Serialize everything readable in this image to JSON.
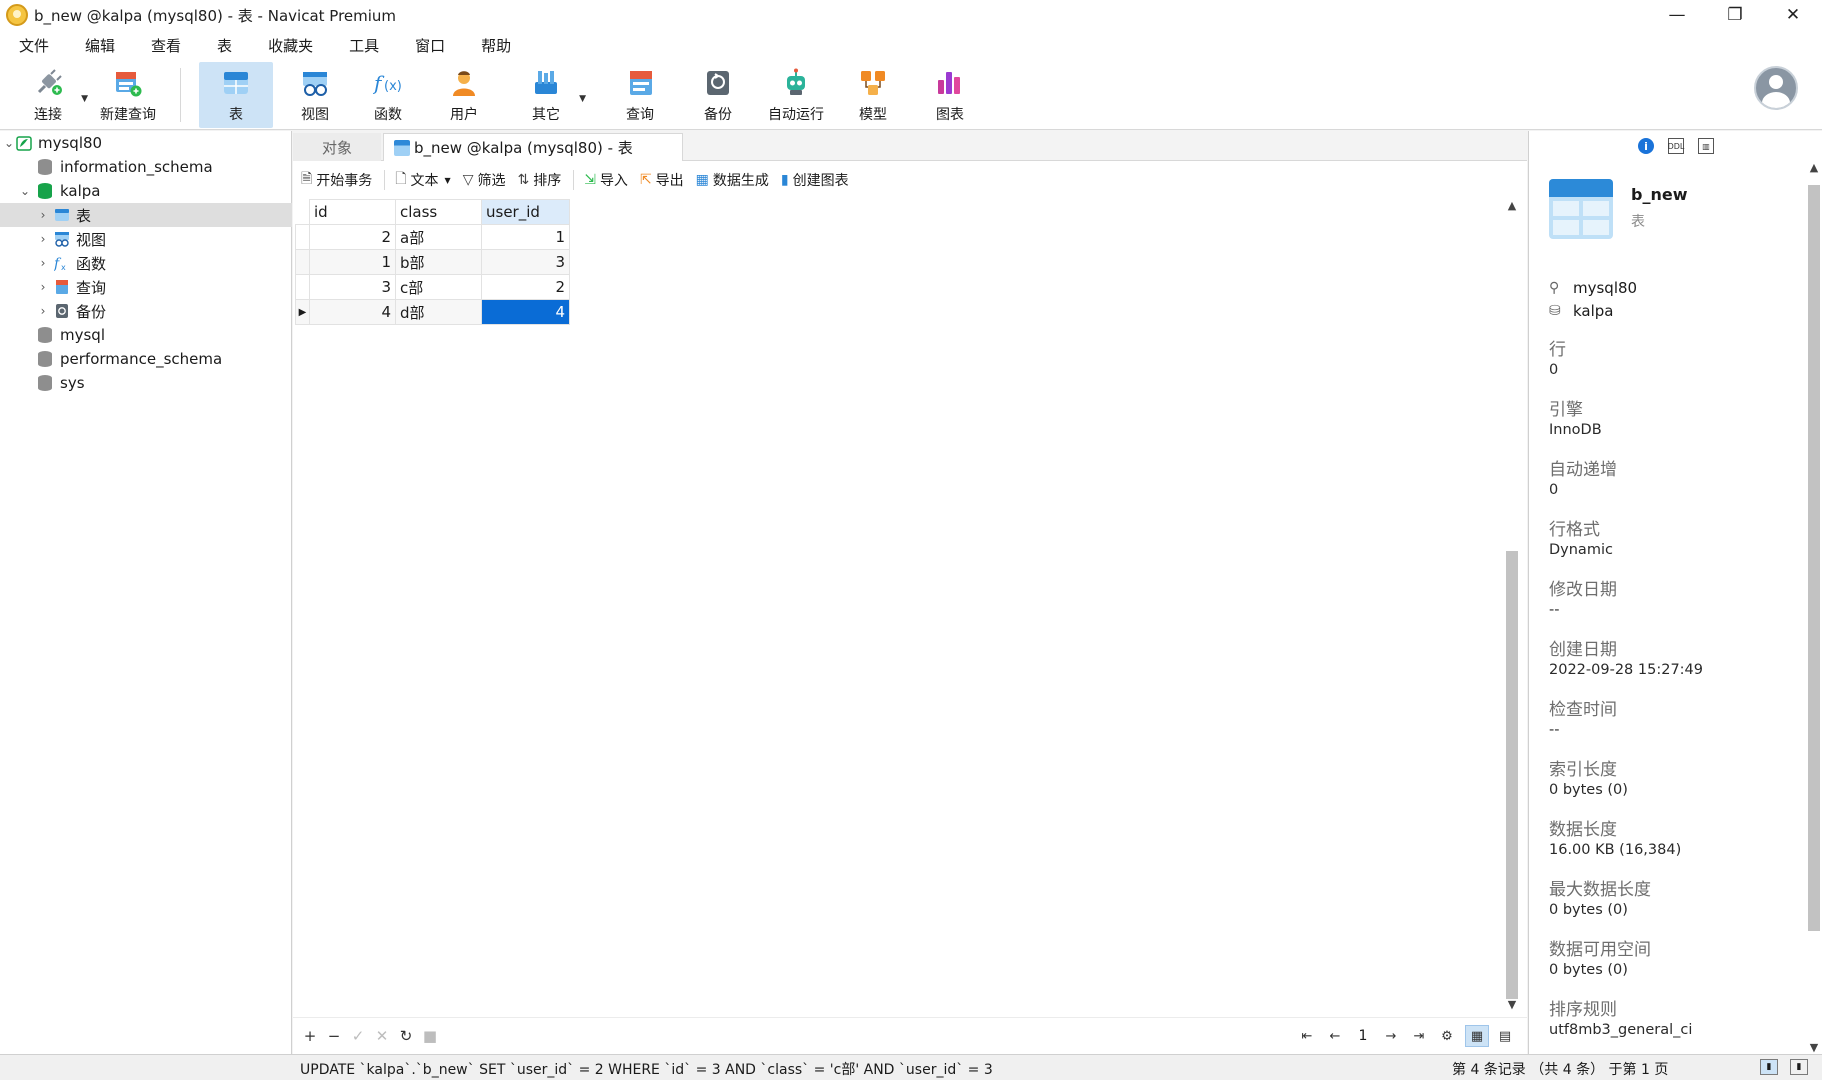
{
  "window": {
    "title": "b_new @kalpa (mysql80) - 表 - Navicat Premium",
    "minimize": "—",
    "restore": "❐",
    "close": "✕"
  },
  "menu": [
    "文件",
    "编辑",
    "查看",
    "表",
    "收藏夹",
    "工具",
    "窗口",
    "帮助"
  ],
  "toolbar": {
    "items": [
      {
        "label": "连接",
        "icon": "connection-plug-icon"
      },
      {
        "label": "新建查询",
        "icon": "new-query-icon"
      },
      {
        "label": "表",
        "icon": "table-icon"
      },
      {
        "label": "视图",
        "icon": "view-glasses-icon"
      },
      {
        "label": "函数",
        "icon": "function-fx-icon"
      },
      {
        "label": "用户",
        "icon": "user-icon"
      },
      {
        "label": "其它",
        "icon": "tools-icon"
      },
      {
        "label": "查询",
        "icon": "query-icon"
      },
      {
        "label": "备份",
        "icon": "backup-icon"
      },
      {
        "label": "自动运行",
        "icon": "robot-icon"
      },
      {
        "label": "模型",
        "icon": "model-icon"
      },
      {
        "label": "图表",
        "icon": "chart-icon"
      }
    ],
    "active_index": 2
  },
  "nav": {
    "items": [
      {
        "label": "mysql80",
        "level": 0,
        "expanded": true,
        "icon": "connection-icon"
      },
      {
        "label": "information_schema",
        "level": 1,
        "icon": "database-icon"
      },
      {
        "label": "kalpa",
        "level": 1,
        "expanded": true,
        "icon": "database-open-icon"
      },
      {
        "label": "表",
        "level": 2,
        "selected": true,
        "icon": "table-icon"
      },
      {
        "label": "视图",
        "level": 2,
        "icon": "view-icon"
      },
      {
        "label": "函数",
        "level": 2,
        "icon": "function-icon"
      },
      {
        "label": "查询",
        "level": 2,
        "icon": "query-icon"
      },
      {
        "label": "备份",
        "level": 2,
        "icon": "backup-icon"
      },
      {
        "label": "mysql",
        "level": 1,
        "icon": "database-icon"
      },
      {
        "label": "performance_schema",
        "level": 1,
        "icon": "database-icon"
      },
      {
        "label": "sys",
        "level": 1,
        "icon": "database-icon"
      }
    ]
  },
  "tabs": {
    "objects": "对象",
    "active": "b_new @kalpa (mysql80) - 表"
  },
  "subtoolbar": {
    "begin_transaction": "开始事务",
    "text": "文本",
    "filter": "筛选",
    "sort": "排序",
    "import": "导入",
    "export": "导出",
    "data_generation": "数据生成",
    "create_chart": "创建图表"
  },
  "grid": {
    "columns": [
      "id",
      "class",
      "user_id"
    ],
    "rows": [
      [
        "2",
        "a部",
        "1"
      ],
      [
        "1",
        "b部",
        "3"
      ],
      [
        "3",
        "c部",
        "2"
      ],
      [
        "4",
        "d部",
        "4"
      ]
    ],
    "current_row": 3,
    "selected_column": 2
  },
  "bottombar": {
    "add": "+",
    "delete": "−",
    "apply": "✓",
    "discard": "✕",
    "refresh": "↻",
    "stop": "■",
    "first": "⇤",
    "prev": "←",
    "page": "1",
    "next": "→",
    "last": "⇥",
    "settings": "⚙",
    "grid_view": "▦",
    "form_view": "▤"
  },
  "info": {
    "name": "b_new",
    "type": "表",
    "connection": "mysql80",
    "database": "kalpa",
    "props": [
      {
        "k": "行",
        "v": "0"
      },
      {
        "k": "引擎",
        "v": "InnoDB"
      },
      {
        "k": "自动递增",
        "v": "0"
      },
      {
        "k": "行格式",
        "v": "Dynamic"
      },
      {
        "k": "修改日期",
        "v": "--"
      },
      {
        "k": "创建日期",
        "v": "2022-09-28 15:27:49"
      },
      {
        "k": "检查时间",
        "v": "--"
      },
      {
        "k": "索引长度",
        "v": "0 bytes (0)"
      },
      {
        "k": "数据长度",
        "v": "16.00 KB (16,384)"
      },
      {
        "k": "最大数据长度",
        "v": "0 bytes (0)"
      },
      {
        "k": "数据可用空间",
        "v": "0 bytes (0)"
      },
      {
        "k": "排序规则",
        "v": "utf8mb3_general_ci"
      }
    ]
  },
  "status": {
    "sql": "UPDATE `kalpa`.`b_new` SET `user_id` = 2 WHERE `id` = 3 AND `class` = 'c部' AND `user_id` = 3",
    "records": "第 4 条记录 （共 4 条） 于第 1 页"
  },
  "colors": {
    "accent": "#0a6cd6",
    "active_tool": "#cde3f6",
    "selected_tree": "#dedede"
  }
}
